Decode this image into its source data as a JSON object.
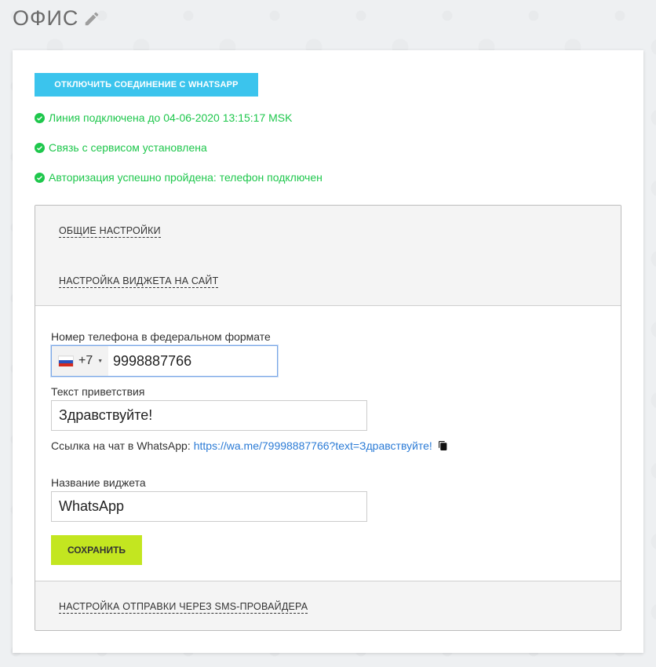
{
  "header": {
    "title": "ОФИС",
    "edit_icon": "pencil-icon"
  },
  "actions": {
    "disconnect_label": "ОТКЛЮЧИТЬ СОЕДИНЕНИЕ С WHATSAPP"
  },
  "statuses": [
    "Линия подключена до 04-06-2020 13:15:17 MSK",
    "Связь с сервисом установлена",
    "Авторизация успешно пройдена: телефон подключен"
  ],
  "accordion": {
    "sections": [
      "ОБЩИЕ НАСТРОЙКИ",
      "НАСТРОЙКА ВИДЖЕТА НА САЙТ",
      "НАСТРОЙКА ОТПРАВКИ ЧЕРЕЗ SMS-ПРОВАЙДЕРА"
    ]
  },
  "widget_form": {
    "phone_label": "Номер телефона в федеральном формате",
    "country_code": "+7",
    "phone_value": "9998887766",
    "greeting_label": "Текст приветствия",
    "greeting_value": "Здравствуйте!",
    "link_label": "Ссылка на чат в WhatsApp:",
    "link_value": "https://wa.me/79998887766?text=Здравствуйте!",
    "widget_name_label": "Название виджета",
    "widget_name_value": "WhatsApp",
    "save_label": "СОХРАНИТЬ"
  },
  "colors": {
    "accent_blue": "#3bc4ed",
    "status_green": "#1ec74c",
    "save_green": "#c3e620",
    "link_blue": "#2b7bd6"
  }
}
